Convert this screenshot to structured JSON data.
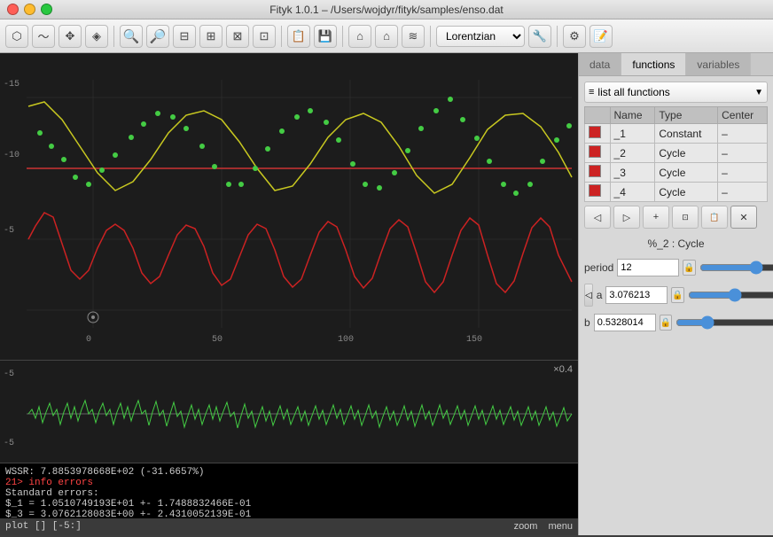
{
  "titlebar": {
    "title": "Fityk 1.0.1 – /Users/wojdyr/fityk/samples/enso.dat"
  },
  "toolbar": {
    "dropdown_lorentzian": "Lorentzian",
    "buttons": [
      "cursor",
      "zoom",
      "move",
      "select",
      "peak-add",
      "peak-remove",
      "peak-split",
      "auto-add",
      "baseline",
      "clear",
      "zoom-in",
      "zoom-out",
      "zoom-reset",
      "zoom-fit",
      "zoom-prev",
      "zoom-next",
      "data-save",
      "data-load",
      "fit",
      "stop",
      "info",
      "script",
      "settings",
      "plugins"
    ]
  },
  "tabs": {
    "data": "data",
    "functions": "functions",
    "variables": "variables"
  },
  "functions_panel": {
    "dropdown_label": "list all functions",
    "table_headers": [
      "Name",
      "Type",
      "Center"
    ],
    "functions": [
      {
        "name": "_1",
        "type": "Constant",
        "center": "–",
        "color": "#cc2222"
      },
      {
        "name": "_2",
        "type": "Cycle",
        "center": "–",
        "color": "#cc2222"
      },
      {
        "name": "_3",
        "type": "Cycle",
        "center": "–",
        "color": "#cc2222"
      },
      {
        "name": "_4",
        "type": "Cycle",
        "center": "–",
        "color": "#cc2222"
      }
    ],
    "func_editor": {
      "current_name": "%_2 : Cycle",
      "params": [
        {
          "label": "period",
          "value": "12",
          "locked": true
        },
        {
          "label": "a",
          "value": "3.076213",
          "locked": true
        },
        {
          "label": "b",
          "value": "0.5328014",
          "locked": true
        }
      ],
      "buttons": [
        "peak-left",
        "peak-right",
        "add-func",
        "fit-area",
        "copy",
        "delete-func"
      ]
    }
  },
  "console": {
    "lines": [
      {
        "text": "WSSR: 7.8853978668E+02 (-31.6657%)",
        "type": "normal"
      },
      {
        "text": "21> info errors",
        "type": "error"
      },
      {
        "text": "Standard errors:",
        "type": "normal"
      },
      {
        "text": "$_1 = 1.0510749193E+01 +- 1.7488832466E-01",
        "type": "normal"
      },
      {
        "text": "$_3 = 3.0762128083E+00 +- 2.4310052139E-01",
        "type": "normal"
      }
    ]
  },
  "statusbar": {
    "left": "plot [] [-5:]",
    "zoom": "zoom",
    "menu": "menu"
  },
  "plot": {
    "upper": {
      "y_labels": [
        "-15",
        "-10",
        "-5"
      ],
      "x_labels": [
        "0",
        "50",
        "100",
        "150"
      ],
      "red_line_y": "-10"
    },
    "lower": {
      "y_labels": [
        "-5",
        "-5"
      ],
      "scale": "×0.4"
    }
  }
}
